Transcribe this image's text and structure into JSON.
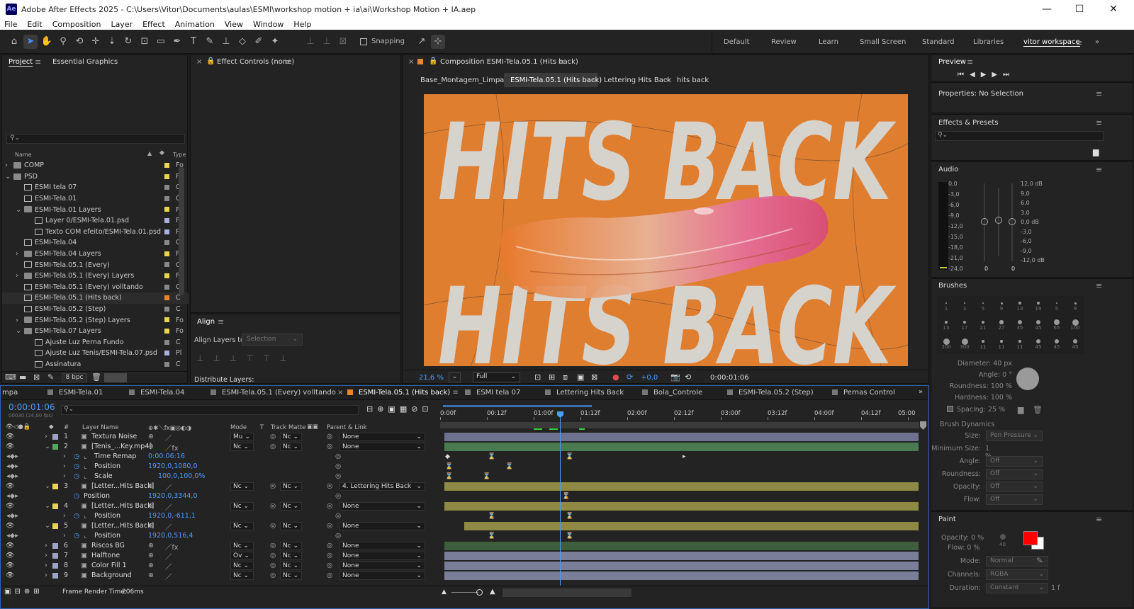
{
  "app": {
    "title": "Adobe After Effects 2025 - C:\\Users\\Vitor\\Documents\\aulas\\ESMI\\workshop motion + ia\\ai\\Workshop Motion + IA.aep",
    "logo": "Ae"
  },
  "menu": [
    "File",
    "Edit",
    "Composition",
    "Layer",
    "Effect",
    "Animation",
    "View",
    "Window",
    "Help"
  ],
  "toolbar": {
    "snapping": "Snapping",
    "workspaces": [
      "Default",
      "Review",
      "Learn",
      "Small Screen",
      "Standard",
      "Libraries",
      "vitor workspace"
    ]
  },
  "project": {
    "tab": "Project",
    "tab2": "Essential Graphics",
    "col_name": "Name",
    "col_type": "Type",
    "bpc": "8 bpc",
    "items": [
      {
        "name": "COMP",
        "type": "Fo",
        "icon": "folder",
        "color": "#e8d44d",
        "indent": 0,
        "arrow": "›"
      },
      {
        "name": "PSD",
        "type": "Fo",
        "icon": "folder",
        "color": "#e8d44d",
        "indent": 0,
        "arrow": "⌄"
      },
      {
        "name": "ESMI tela 07",
        "type": "C",
        "icon": "comp",
        "color": "#888",
        "indent": 1,
        "arrow": ""
      },
      {
        "name": "ESMI-Tela.01",
        "type": "C",
        "icon": "comp",
        "color": "#888",
        "indent": 1,
        "arrow": ""
      },
      {
        "name": "ESMI-Tela.01 Layers",
        "type": "Fo",
        "icon": "folder",
        "color": "#e8d44d",
        "indent": 1,
        "arrow": "⌄"
      },
      {
        "name": "Layer 0/ESMI-Tela.01.psd",
        "type": "Pl",
        "icon": "psd",
        "color": "#aab0e0",
        "indent": 2,
        "arrow": ""
      },
      {
        "name": "Texto COM efeito/ESMI-Tela.01.psd",
        "type": "Pl",
        "icon": "psd",
        "color": "#aab0e0",
        "indent": 2,
        "arrow": ""
      },
      {
        "name": "ESMI-Tela.04",
        "type": "C",
        "icon": "comp",
        "color": "#888",
        "indent": 1,
        "arrow": ""
      },
      {
        "name": "ESMI-Tela.04 Layers",
        "type": "Fo",
        "icon": "folder",
        "color": "#e8d44d",
        "indent": 1,
        "arrow": "›"
      },
      {
        "name": "ESMI-Tela.05.1 (Every)",
        "type": "C",
        "icon": "comp",
        "color": "#888",
        "indent": 1,
        "arrow": ""
      },
      {
        "name": "ESMI-Tela.05.1 (Every) Layers",
        "type": "Fo",
        "icon": "folder",
        "color": "#e8d44d",
        "indent": 1,
        "arrow": "›"
      },
      {
        "name": "ESMI-Tela.05.1 (Every) volltando",
        "type": "C",
        "icon": "comp",
        "color": "#888",
        "indent": 1,
        "arrow": ""
      },
      {
        "name": "ESMI-Tela.05.1 (Hits back)",
        "type": "C",
        "icon": "comp",
        "color": "#e8862a",
        "indent": 1,
        "arrow": ""
      },
      {
        "name": "ESMI-Tela.05.2 (Step)",
        "type": "C",
        "icon": "comp",
        "color": "#888",
        "indent": 1,
        "arrow": ""
      },
      {
        "name": "ESMI-Tela.05.2 (Step) Layers",
        "type": "Fo",
        "icon": "folder",
        "color": "#e8d44d",
        "indent": 1,
        "arrow": "›"
      },
      {
        "name": "ESMI-Tela.07 Layers",
        "type": "Fo",
        "icon": "folder",
        "color": "#e8d44d",
        "indent": 1,
        "arrow": "⌄"
      },
      {
        "name": "Ajuste Luz Perna Fundo",
        "type": "C",
        "icon": "comp",
        "color": "#888",
        "indent": 2,
        "arrow": ""
      },
      {
        "name": "Ajuste Luz Tenis/ESMI-Tela.07.psd",
        "type": "Pl",
        "icon": "psd",
        "color": "#aab0e0",
        "indent": 2,
        "arrow": ""
      },
      {
        "name": "Assinatura",
        "type": "C",
        "icon": "comp",
        "color": "#888",
        "indent": 2,
        "arrow": ""
      }
    ]
  },
  "effect_controls": {
    "title": "Effect Controls (none)"
  },
  "align": {
    "title": "Align",
    "align_to_label": "Align Layers to:",
    "align_to_value": "Selection",
    "distribute": "Distribute Layers:"
  },
  "composition": {
    "title": "Composition ESMI-Tela.05.1 (Hits back)",
    "breadcrumbs": [
      "Base_Montagem_Limpa",
      "ESMI-Tela.05.1 (Hits back)",
      "Lettering Hits Back",
      "hits back"
    ],
    "zoom": "21,6 %",
    "quality": "Full",
    "exposure": "+0,0",
    "timecode": "0:00:01:06",
    "artwork_text": "HITS BACK"
  },
  "right": {
    "preview": "Preview",
    "properties": "Properties: No Selection",
    "effects": "Effects & Presets",
    "audio": "Audio",
    "audio_left": [
      "0,0",
      "-3,0",
      "-6,0",
      "-9,0",
      "-12,0",
      "-15,0",
      "-18,0",
      "-21,0",
      "-24,0"
    ],
    "audio_right": [
      "12,0 dB",
      "9,0",
      "6,0",
      "3,0",
      "0,0 dB",
      "-3,0",
      "-6,0",
      "-9,0",
      "-12,0 dB"
    ],
    "audio_zero": "0",
    "brushes": "Brushes",
    "brush_sizes": [
      [
        "1",
        "3",
        "5",
        "9",
        "13",
        "19",
        "5",
        "9"
      ],
      [
        "13",
        "17",
        "21",
        "27",
        "35",
        "45",
        "65",
        "100"
      ],
      [
        "200",
        "300",
        "11",
        "11",
        "11",
        "45",
        "45",
        "45"
      ]
    ],
    "brush_props": [
      {
        "label": "Diameter:",
        "value": "40 px"
      },
      {
        "label": "Angle:",
        "value": "0 °"
      },
      {
        "label": "Roundness:",
        "value": "100 %"
      },
      {
        "label": "Hardness:",
        "value": "100 %"
      }
    ],
    "spacing": "Spacing: 25 %",
    "dynamics": "Brush Dynamics",
    "dyn": [
      {
        "label": "Size:",
        "value": "Pen Pressure"
      },
      {
        "label": "Minimum Size:",
        "value": "1 %"
      },
      {
        "label": "Angle:",
        "value": "Off"
      },
      {
        "label": "Roundness:",
        "value": "Off"
      },
      {
        "label": "Opacity:",
        "value": "Off"
      },
      {
        "label": "Flow:",
        "value": "Off"
      }
    ],
    "paint": "Paint",
    "paint_opacity": "Opacity: 0 %",
    "paint_flow": "Flow: 0 %",
    "paint_num": "40",
    "paint_mode_label": "Mode:",
    "paint_mode": "Normal",
    "paint_channels_label": "Channels:",
    "paint_channels": "RGBA",
    "paint_duration_label": "Duration:",
    "paint_duration": "Constant",
    "paint_f": "1 f",
    "fg_color": "#ff0000"
  },
  "timeline": {
    "tabs": [
      "mpa",
      "ESMI-Tela.01",
      "ESMI-Tela.04",
      "ESMI-Tela.05.1 (Every) volltando",
      "ESMI-Tela.05.1 (Hits back)",
      "ESMI tela 07",
      "Lettering Hits Back",
      "Bola_Controle",
      "ESMI-Tela.05.2 (Step)",
      "Pernas Control"
    ],
    "timecode": "0:00:01:06",
    "fps": "00030 (24,00 fps)",
    "headers": {
      "layer_name": "Layer Name",
      "mode": "Mode",
      "t": "T",
      "track_matte": "Track Matte",
      "parent": "Parent & Link"
    },
    "ruler": [
      "0:00f",
      "00:12f",
      "01:00f",
      "01:12f",
      "02:00f",
      "02:12f",
      "03:00f",
      "03:12f",
      "04:00f",
      "04:12f",
      "05:00"
    ],
    "render_label": "Frame Render Time:",
    "render_time": "206ms",
    "layers": [
      {
        "num": "1",
        "name": "Textura Noise",
        "mode": "Mu",
        "matte": "Nc",
        "parent": "None",
        "color": "#9ea2c4",
        "bar": "#6e7290",
        "prop": false,
        "fx": false
      },
      {
        "num": "2",
        "name": "[Tenis_...Key.mp4]",
        "mode": "Nc",
        "matte": "Nc",
        "parent": "None",
        "color": "#55a860",
        "bar": "#4a7a50",
        "prop": false,
        "fx": true
      },
      {
        "num": "",
        "name": "Time Remap",
        "value": "0:00:06:16",
        "prop": true
      },
      {
        "num": "",
        "name": "Position",
        "value": "1920,0,1080,0",
        "prop": true
      },
      {
        "num": "",
        "name": "Scale",
        "value": "100,0,100,0%",
        "prop": true
      },
      {
        "num": "3",
        "name": "[Letter...Hits Back]",
        "mode": "Nc",
        "matte": "Nc",
        "parent": "4. Lettering Hits Back",
        "color": "#e8d44d",
        "bar": "#8e8a45",
        "prop": false,
        "fx": false
      },
      {
        "num": "",
        "name": "Position",
        "value": "1920,0,3344,0",
        "prop": true
      },
      {
        "num": "4",
        "name": "[Letter...Hits Back]",
        "mode": "Nc",
        "matte": "Nc",
        "parent": "None",
        "color": "#e8d44d",
        "bar": "#8e8a45",
        "prop": false,
        "fx": false
      },
      {
        "num": "",
        "name": "Position",
        "value": "1920,0,-611,1",
        "prop": true
      },
      {
        "num": "5",
        "name": "[Letter...Hits Back]",
        "mode": "Nc",
        "matte": "Nc",
        "parent": "None",
        "color": "#e8d44d",
        "bar": "#8e8a45",
        "prop": false,
        "fx": false
      },
      {
        "num": "",
        "name": "Position",
        "value": "1920,0,516,4",
        "prop": true
      },
      {
        "num": "6",
        "name": "Riscos BG",
        "mode": "Nc",
        "matte": "Nc",
        "parent": "None",
        "color": "#9ea2c4",
        "bar": "#3e5e3e",
        "prop": false,
        "fx": true
      },
      {
        "num": "7",
        "name": "Halftone",
        "mode": "Ov",
        "matte": "Nc",
        "parent": "None",
        "color": "#9ea2c4",
        "bar": "#7a7e98",
        "prop": false,
        "fx": false
      },
      {
        "num": "8",
        "name": "Color Fill 1",
        "mode": "Nc",
        "matte": "Nc",
        "parent": "None",
        "color": "#9ea2c4",
        "bar": "#7a7e98",
        "prop": false,
        "fx": false
      },
      {
        "num": "9",
        "name": "Background",
        "mode": "Nc",
        "matte": "Nc",
        "parent": "None",
        "color": "#9ea2c4",
        "bar": "#7a7e98",
        "prop": false,
        "fx": false
      }
    ]
  }
}
